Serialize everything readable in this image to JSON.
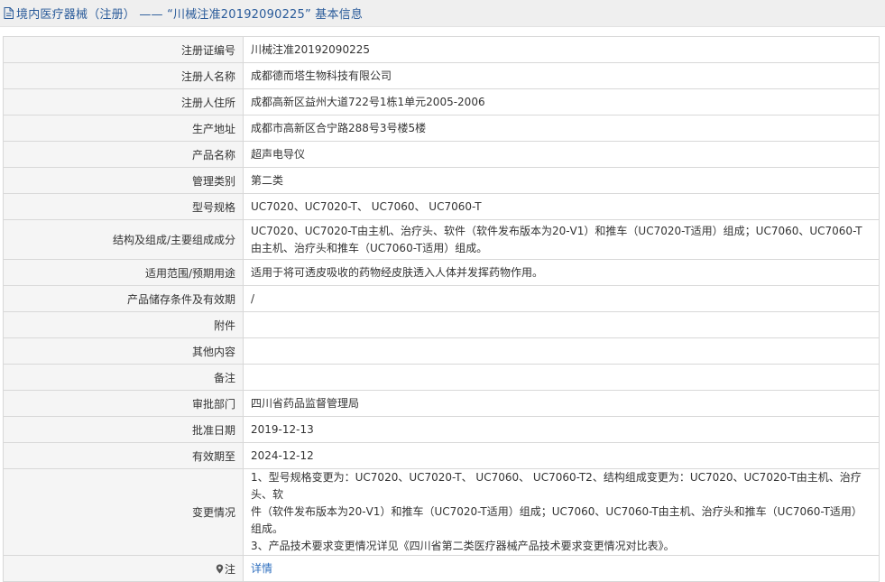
{
  "header": {
    "title": "境内医疗器械（注册） —— “川械注准20192090225” 基本信息"
  },
  "rows": [
    {
      "label": "注册证编号",
      "value": "川械注准20192090225"
    },
    {
      "label": "注册人名称",
      "value": "成都德而塔生物科技有限公司"
    },
    {
      "label": "注册人住所",
      "value": "成都高新区益州大道722号1栋1单元2005-2006"
    },
    {
      "label": "生产地址",
      "value": "成都市高新区合宁路288号3号楼5楼"
    },
    {
      "label": "产品名称",
      "value": "超声电导仪"
    },
    {
      "label": "管理类别",
      "value": "第二类"
    },
    {
      "label": "型号规格",
      "value": "UC7020、UC7020-T、 UC7060、 UC7060-T"
    },
    {
      "label": "结构及组成/主要组成成分",
      "value": "UC7020、UC7020-T由主机、治疗头、软件（软件发布版本为20-V1）和推车（UC7020-T适用）组成；UC7060、UC7060-T由主机、治疗头和推车（UC7060-T适用）组成。"
    },
    {
      "label": "适用范围/预期用途",
      "value": "适用于将可透皮吸收的药物经皮肤透入人体并发挥药物作用。"
    },
    {
      "label": "产品储存条件及有效期",
      "value": "/"
    },
    {
      "label": "附件",
      "value": ""
    },
    {
      "label": "其他内容",
      "value": ""
    },
    {
      "label": "备注",
      "value": ""
    },
    {
      "label": "审批部门",
      "value": "四川省药品监督管理局"
    },
    {
      "label": "批准日期",
      "value": "2019-12-13"
    },
    {
      "label": "有效期至",
      "value": "2024-12-12"
    }
  ],
  "change": {
    "label": "变更情况",
    "lines": [
      "1、型号规格变更为：UC7020、UC7020-T、 UC7060、 UC7060-T2、结构组成变更为：UC7020、UC7020-T由主机、治疗头、软",
      "件（软件发布版本为20-V1）和推车（UC7020-T适用）组成；UC7060、UC7060-T由主机、治疗头和推车（UC7060-T适用）组成。",
      "3、产品技术要求变更情况详见《四川省第二类医疗器械产品技术要求变更情况对比表》。"
    ]
  },
  "note": {
    "label": "注",
    "link_text": "详情"
  },
  "colors": {
    "title": "#2a5b9a",
    "link": "#2f6fbf",
    "label_bg": "#f5f5f5",
    "border": "#d8d8d8"
  },
  "icons": {
    "title_icon": "document-icon",
    "note_icon": "map-pin-icon"
  }
}
